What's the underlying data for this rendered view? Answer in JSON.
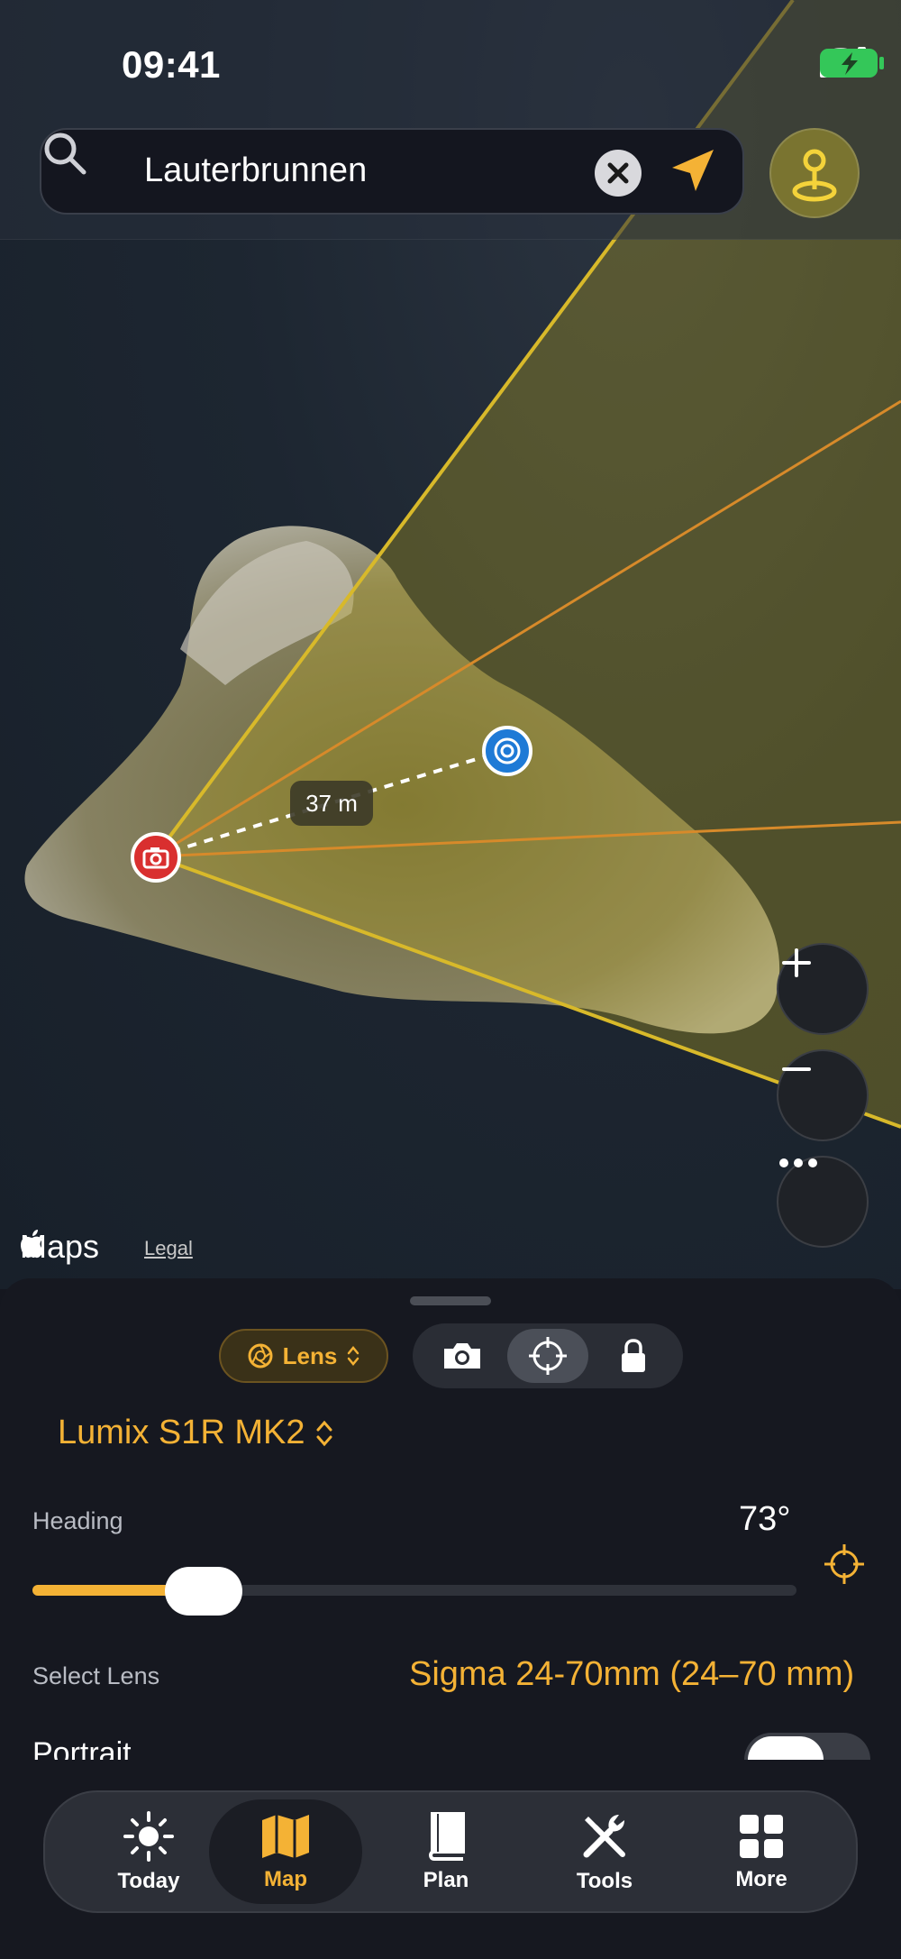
{
  "status_bar": {
    "time": "09:41"
  },
  "search": {
    "query": "Lauterbrunnen"
  },
  "map": {
    "distance_label": "37 m",
    "attribution": "Maps",
    "legal": "Legal"
  },
  "sheet": {
    "lens_chip": "Lens",
    "camera_model": "Lumix S1R MK2",
    "heading_label": "Heading",
    "heading_value": "73°",
    "heading_slider_fraction": 0.2,
    "select_lens_label": "Select Lens",
    "selected_lens": "Sigma 24-70mm (24–70 mm)",
    "portrait_label": "Portrait"
  },
  "tabs": [
    {
      "label": "Today",
      "icon": "sun-icon"
    },
    {
      "label": "Map",
      "icon": "map-icon",
      "active": true
    },
    {
      "label": "Plan",
      "icon": "book-icon"
    },
    {
      "label": "Tools",
      "icon": "tools-icon"
    },
    {
      "label": "More",
      "icon": "grid-icon"
    }
  ],
  "colors": {
    "accent": "#f4b235",
    "battery": "#34c759",
    "camera_pin": "#d92f2f",
    "target_pin": "#1e7ad6"
  }
}
